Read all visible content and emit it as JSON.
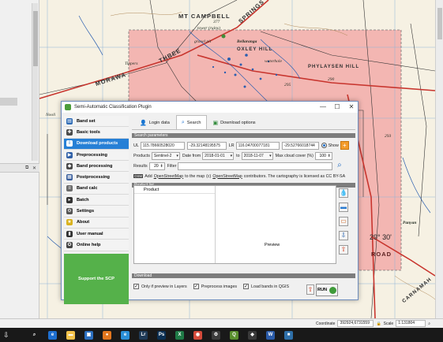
{
  "map": {
    "labels": {
      "mt_campbell": "MT CAMPBELL",
      "tower_ruins": "tower (ruins)",
      "springs": "SPRINGS",
      "gravel_pit": "gravel pit",
      "bellaranga": "Bellaranga",
      "oxley_hill": "OXLEY HILL",
      "waterhole": "waterhole",
      "tippers": "Tippers",
      "morawa": "MORAWA",
      "three": "THREE",
      "phylaysen_hill": "PHYLAYSEN HILL",
      "nooli": "Nooli",
      "panyan": "Panyan",
      "carnamah": "CARNAMAH",
      "road": "ROAD",
      "grid_29_30": "29° 30'",
      "spot_290": "290",
      "spot_293": "293",
      "spot_377": "377",
      "spot_295": "295"
    }
  },
  "statusbar": {
    "coordinate_label": "Coordinate",
    "coordinate_value": "392924,6731559",
    "scale_label": "Scale",
    "scale_value": "1:131804"
  },
  "dialog": {
    "title": "Semi-Automatic Classification Plugin",
    "controls": {
      "minimize": "—",
      "maximize": "☐",
      "close": "✕"
    },
    "sidebar": [
      {
        "label": "Band set",
        "icon": "band-set-icon",
        "color": "#2d6ab5"
      },
      {
        "label": "Basic tools",
        "icon": "basic-tools-icon",
        "color": "#4b4b4b"
      },
      {
        "label": "Download products",
        "icon": "download-products-icon",
        "color": "#3b7fd6"
      },
      {
        "label": "Preprocessing",
        "icon": "preprocessing-icon",
        "color": "#3161a8"
      },
      {
        "label": "Band processing",
        "icon": "band-processing-icon",
        "color": "#4a4a4a"
      },
      {
        "label": "Postprocessing",
        "icon": "postprocessing-icon",
        "color": "#395e9c"
      },
      {
        "label": "Band calc",
        "icon": "band-calc-icon",
        "color": "#6b6b6b"
      },
      {
        "label": "Batch",
        "icon": "batch-icon",
        "color": "#333333"
      },
      {
        "label": "Settings",
        "icon": "settings-icon",
        "color": "#555555"
      },
      {
        "label": "About",
        "icon": "about-icon",
        "color": "#d9b21f"
      },
      {
        "label": "User manual",
        "icon": "user-manual-icon",
        "color": "#333333"
      },
      {
        "label": "Online help",
        "icon": "online-help-icon",
        "color": "#444444"
      }
    ],
    "support_label": "Support the SCP",
    "tabs": [
      {
        "label": "Login data",
        "icon": "login-icon"
      },
      {
        "label": "Search",
        "icon": "search-icon"
      },
      {
        "label": "Download options",
        "icon": "download-options-icon"
      }
    ],
    "search": {
      "section_title": "Search parameters",
      "ul_label": "UL",
      "ul_x": "115.78660528020",
      "ul_y": "-29.32148195575",
      "lr_label": "LR",
      "lr_x": "116.04700077181",
      "lr_y": "-29.52766018744",
      "show_label": "Show",
      "products_label": "Products",
      "products_value": "Sentinel-2",
      "date_from_label": "Date from",
      "date_from_value": "2018-01-01",
      "to_label": "to",
      "date_to_value": "2018-11-07",
      "cloud_label": "Max cloud cover (%)",
      "cloud_value": "100",
      "results_label": "Results",
      "results_value": "20",
      "filter_label": "Filter",
      "filter_value": "",
      "osm_badge": "OSM",
      "osm_text_pre": "Add",
      "osm_link": "OpenStreetMap",
      "osm_text_post": "to the map",
      "osm_credit_link": "OpenStreetMap",
      "osm_credit_post": "contributors. The cartography is licensed as CC BY-SA"
    },
    "product_list": {
      "section_title": "Product list",
      "column_product": "Product",
      "preview_label": "Preview"
    },
    "download": {
      "section_title": "Download",
      "only_preview": "Only if preview in Layers",
      "preprocess": "Preprocess images",
      "load_bands": "Load bands in QGIS",
      "run_label": "RUN"
    }
  },
  "taskbar": {
    "icons": [
      {
        "name": "search-icon",
        "glyph": "⌕",
        "color": "#191919"
      },
      {
        "name": "edge-icon",
        "glyph": "e",
        "color": "#1e6fd0"
      },
      {
        "name": "file-explorer-icon",
        "glyph": "▬",
        "color": "#f3c24a"
      },
      {
        "name": "store-icon",
        "glyph": "▣",
        "color": "#2c6fbf"
      },
      {
        "name": "firefox-icon",
        "glyph": "●",
        "color": "#e2761e"
      },
      {
        "name": "ie-icon",
        "glyph": "e",
        "color": "#2a8fd8"
      },
      {
        "name": "lightroom-icon",
        "glyph": "Lr",
        "color": "#1f3a56"
      },
      {
        "name": "photoshop-icon",
        "glyph": "Ps",
        "color": "#0b2f52"
      },
      {
        "name": "excel-icon",
        "glyph": "X",
        "color": "#1f7a46"
      },
      {
        "name": "chrome-icon",
        "glyph": "◉",
        "color": "#d44a3a"
      },
      {
        "name": "settings-icon",
        "glyph": "⚙",
        "color": "#3c3c3c"
      },
      {
        "name": "qgis-icon",
        "glyph": "Q",
        "color": "#5a8f2e"
      },
      {
        "name": "app-icon",
        "glyph": "◆",
        "color": "#3a3a3a"
      },
      {
        "name": "word-icon",
        "glyph": "W",
        "color": "#2a5ba8"
      },
      {
        "name": "app2-icon",
        "glyph": "■",
        "color": "#2e6fa8"
      }
    ]
  }
}
